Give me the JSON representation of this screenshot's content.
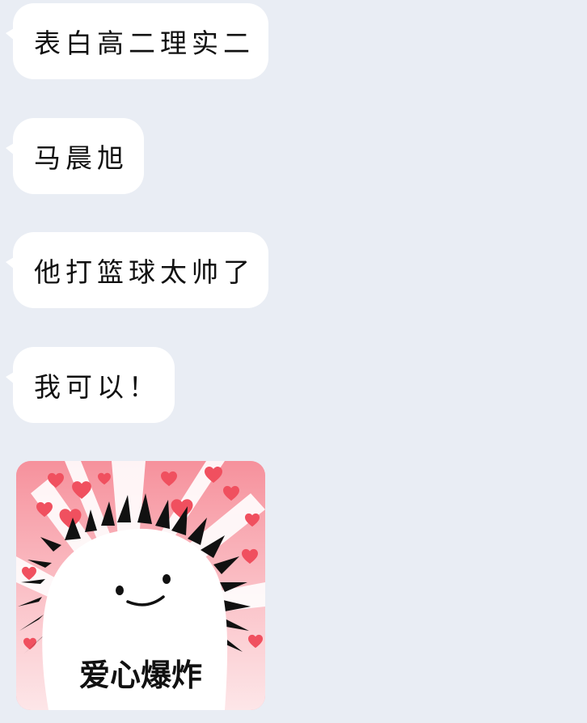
{
  "messages": [
    {
      "text": "表白高二理实二"
    },
    {
      "text": "马晨旭"
    },
    {
      "text": "他打篮球太帅了"
    },
    {
      "text": "我可以！"
    }
  ],
  "sticker": {
    "caption": "爱心爆炸",
    "background_color": "#f7a4ad",
    "heart_color": "#f0505f"
  }
}
